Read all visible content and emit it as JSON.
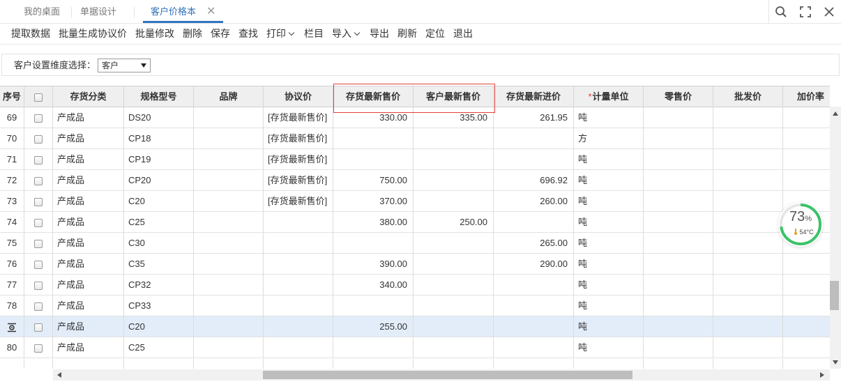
{
  "tabs": [
    {
      "label": "我的桌面"
    },
    {
      "label": "单据设计"
    },
    {
      "label": "客户价格本"
    }
  ],
  "toolbar": {
    "items": [
      "提取数据",
      "批量生成协议价",
      "批量修改",
      "删除",
      "保存",
      "查找",
      "打印",
      "栏目",
      "导入",
      "导出",
      "刷新",
      "定位",
      "退出"
    ]
  },
  "filter": {
    "label": "客户设置维度选择：",
    "selected": "客户"
  },
  "columns": [
    "序号",
    "",
    "存货分类",
    "规格型号",
    "品牌",
    "协议价",
    "存货最新售价",
    "客户最新售价",
    "存货最新进价",
    "计量单位",
    "零售价",
    "批发价",
    "加价率"
  ],
  "required_marker": "*",
  "rows": [
    {
      "seq": "69",
      "category": "产成品",
      "model": "DS20",
      "brand": "",
      "agreement": "[存货最新售价]",
      "stock_sale": "330.00",
      "cust_sale": "335.00",
      "stock_purchase": "261.95",
      "unit": "吨",
      "retail": "",
      "wholesale": "",
      "markup": ""
    },
    {
      "seq": "70",
      "category": "产成品",
      "model": "CP18",
      "brand": "",
      "agreement": "[存货最新售价]",
      "stock_sale": "",
      "cust_sale": "",
      "stock_purchase": "",
      "unit": "方",
      "retail": "",
      "wholesale": "",
      "markup": ""
    },
    {
      "seq": "71",
      "category": "产成品",
      "model": "CP19",
      "brand": "",
      "agreement": "[存货最新售价]",
      "stock_sale": "",
      "cust_sale": "",
      "stock_purchase": "",
      "unit": "吨",
      "retail": "",
      "wholesale": "",
      "markup": ""
    },
    {
      "seq": "72",
      "category": "产成品",
      "model": "CP20",
      "brand": "",
      "agreement": "[存货最新售价]",
      "stock_sale": "750.00",
      "cust_sale": "",
      "stock_purchase": "696.92",
      "unit": "吨",
      "retail": "",
      "wholesale": "",
      "markup": ""
    },
    {
      "seq": "73",
      "category": "产成品",
      "model": "C20",
      "brand": "",
      "agreement": "[存货最新售价]",
      "stock_sale": "370.00",
      "cust_sale": "",
      "stock_purchase": "260.00",
      "unit": "吨",
      "retail": "",
      "wholesale": "",
      "markup": ""
    },
    {
      "seq": "74",
      "category": "产成品",
      "model": "C25",
      "brand": "",
      "agreement": "",
      "stock_sale": "380.00",
      "cust_sale": "250.00",
      "stock_purchase": "",
      "unit": "吨",
      "retail": "",
      "wholesale": "",
      "markup": ""
    },
    {
      "seq": "75",
      "category": "产成品",
      "model": "C30",
      "brand": "",
      "agreement": "",
      "stock_sale": "",
      "cust_sale": "",
      "stock_purchase": "265.00",
      "unit": "吨",
      "retail": "",
      "wholesale": "",
      "markup": ""
    },
    {
      "seq": "76",
      "category": "产成品",
      "model": "C35",
      "brand": "",
      "agreement": "",
      "stock_sale": "390.00",
      "cust_sale": "",
      "stock_purchase": "290.00",
      "unit": "吨",
      "retail": "",
      "wholesale": "",
      "markup": ""
    },
    {
      "seq": "77",
      "category": "产成品",
      "model": "CP32",
      "brand": "",
      "agreement": "",
      "stock_sale": "340.00",
      "cust_sale": "",
      "stock_purchase": "",
      "unit": "吨",
      "retail": "",
      "wholesale": "",
      "markup": ""
    },
    {
      "seq": "78",
      "category": "产成品",
      "model": "CP33",
      "brand": "",
      "agreement": "",
      "stock_sale": "",
      "cust_sale": "",
      "stock_purchase": "",
      "unit": "吨",
      "retail": "",
      "wholesale": "",
      "markup": ""
    },
    {
      "seq": "",
      "category": "产成品",
      "model": "C20",
      "brand": "",
      "agreement": "",
      "stock_sale": "255.00",
      "cust_sale": "",
      "stock_purchase": "",
      "unit": "吨",
      "retail": "",
      "wholesale": "",
      "markup": "",
      "selected": true,
      "row_icon": "row-edit-icon"
    },
    {
      "seq": "80",
      "category": "产成品",
      "model": "C25",
      "brand": "",
      "agreement": "",
      "stock_sale": "",
      "cust_sale": "",
      "stock_purchase": "",
      "unit": "吨",
      "retail": "",
      "wholesale": "",
      "markup": ""
    }
  ],
  "widget": {
    "percent": "73",
    "percent_unit": "%",
    "temperature": "54°C",
    "level": 0.73
  },
  "colors": {
    "accent": "#2f74c0",
    "highlight_border": "#e0413b",
    "selected_row": "#e3edf9",
    "widget_ring": "#3cc36a"
  },
  "icons": [
    "search-icon",
    "fullscreen-icon",
    "close-icon",
    "tab-close-icon",
    "row-edit-icon",
    "thermometer-icon"
  ]
}
